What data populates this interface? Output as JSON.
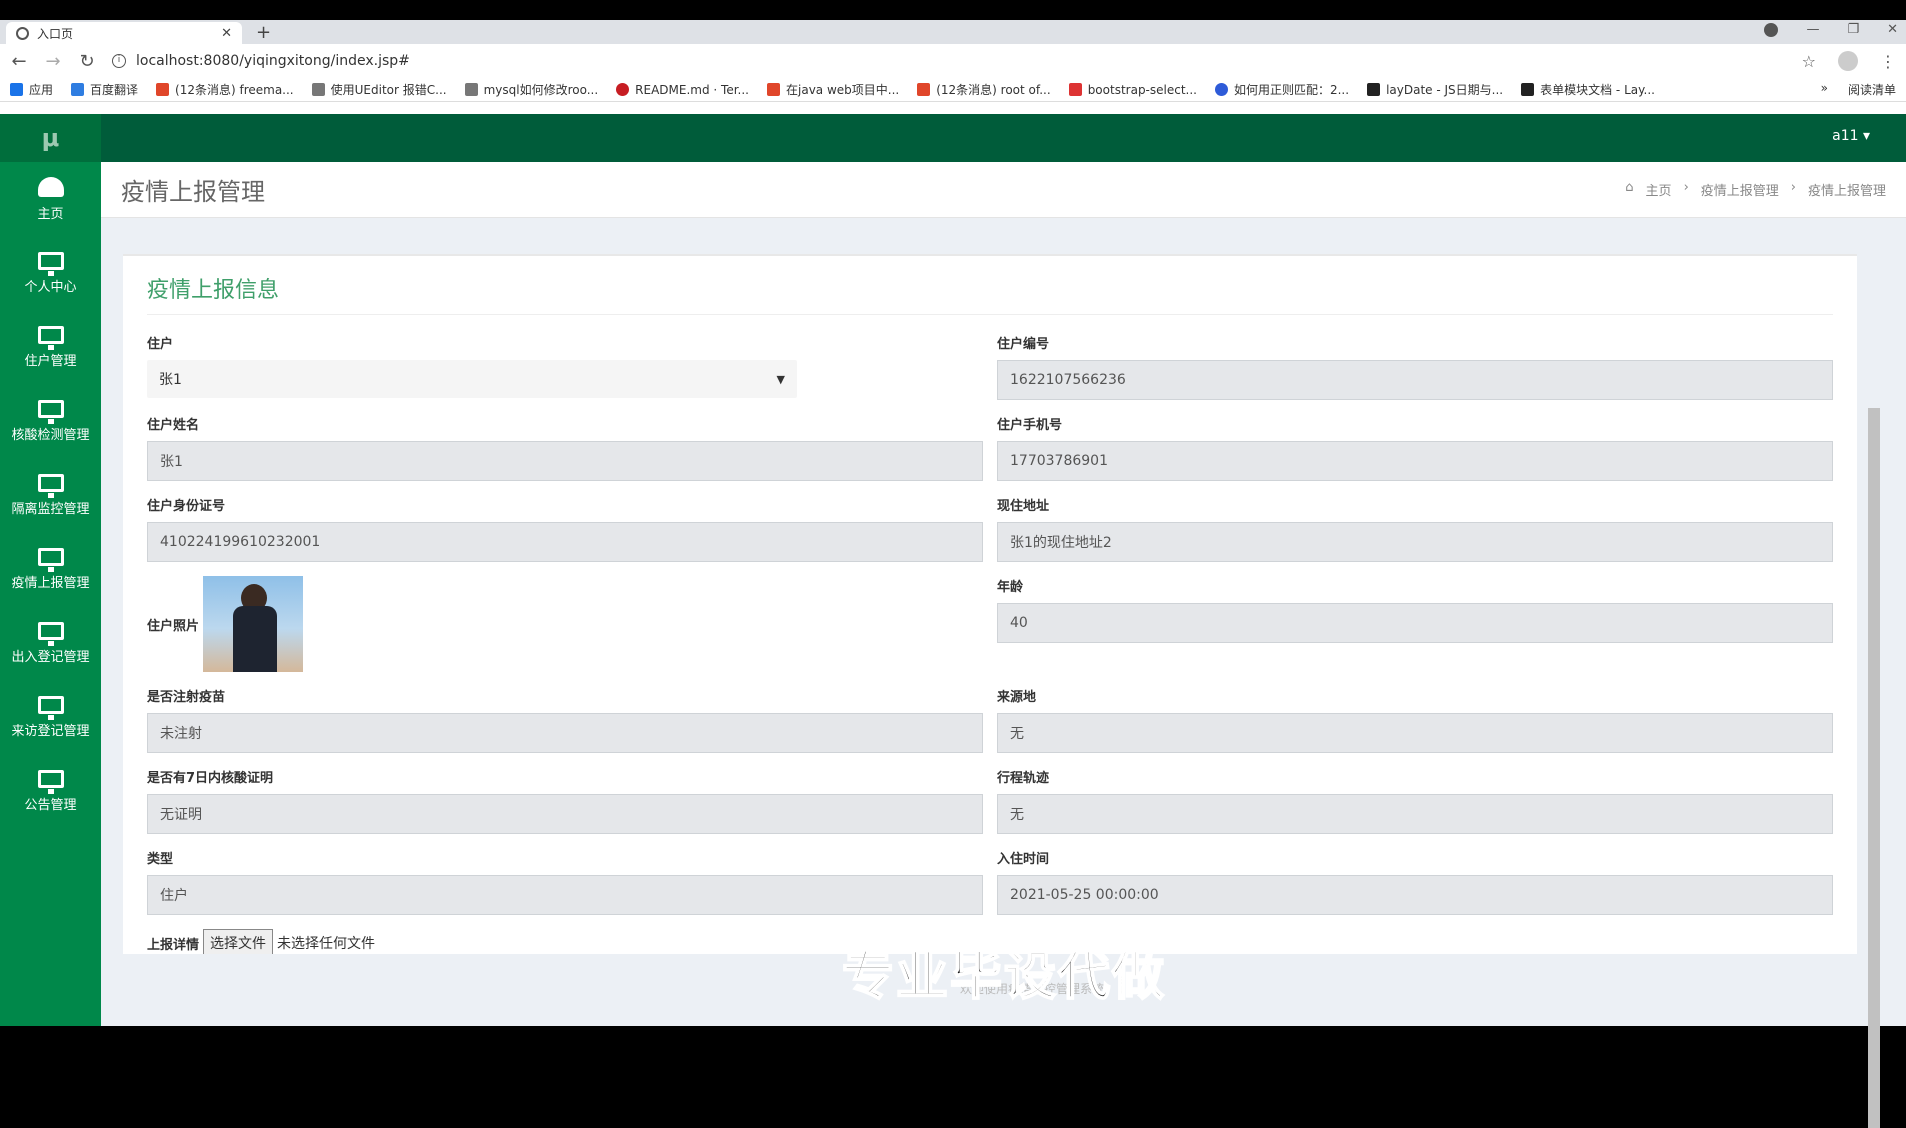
{
  "browser": {
    "tab_title": "入口页",
    "url": "localhost:8080/yiqingxitong/index.jsp#",
    "bookmarks": [
      "应用",
      "百度翻译",
      "(12条消息) freema...",
      "使用UEditor 报错C...",
      "mysql如何修改roo...",
      "README.md · Ter...",
      "在java web项目中...",
      "(12条消息) root of...",
      "bootstrap-select...",
      "如何用正则匹配：2...",
      "layDate - JS日期与...",
      "表单模块文档 - Lay..."
    ],
    "bookmarks_end": [
      "»",
      "阅读清单"
    ]
  },
  "app": {
    "logo": "μ",
    "user": "a11 ▾",
    "sidebar": [
      {
        "label": "主页",
        "icon": "dashboard-icon"
      },
      {
        "label": "个人中心",
        "icon": "monitor-icon"
      },
      {
        "label": "住户管理",
        "icon": "monitor-icon"
      },
      {
        "label": "核酸检测管理",
        "icon": "monitor-icon"
      },
      {
        "label": "隔离监控管理",
        "icon": "monitor-icon"
      },
      {
        "label": "疫情上报管理",
        "icon": "monitor-icon"
      },
      {
        "label": "出入登记管理",
        "icon": "monitor-icon"
      },
      {
        "label": "来访登记管理",
        "icon": "monitor-icon"
      },
      {
        "label": "公告管理",
        "icon": "monitor-icon"
      }
    ],
    "page_title": "疫情上报管理",
    "breadcrumb": [
      "主页",
      "疫情上报管理",
      "疫情上报管理"
    ],
    "panel_title": "疫情上报信息",
    "form": {
      "resident_label": "住户",
      "resident_value": "张1",
      "resident_no_label": "住户编号",
      "resident_no_value": "1622107566236",
      "name_label": "住户姓名",
      "name_value": "张1",
      "phone_label": "住户手机号",
      "phone_value": "17703786901",
      "id_label": "住户身份证号",
      "id_value": "410224199610232001",
      "address_label": "现住地址",
      "address_value": "张1的现住地址2",
      "photo_label": "住户照片",
      "age_label": "年龄",
      "age_value": "40",
      "vaccine_label": "是否注射疫苗",
      "vaccine_value": "未注射",
      "origin_label": "来源地",
      "origin_value": "无",
      "nucleic_label": "是否有7日内核酸证明",
      "nucleic_value": "无证明",
      "trip_label": "行程轨迹",
      "trip_value": "无",
      "type_label": "类型",
      "type_value": "住户",
      "checkin_label": "入住时间",
      "checkin_value": "2021-05-25 00:00:00",
      "detail_label": "上报详情",
      "file_button": "选择文件",
      "file_status": "未选择任何文件"
    },
    "watermark": "专业毕设代做",
    "footer": "欢迎使用疫情防控管理系统"
  }
}
